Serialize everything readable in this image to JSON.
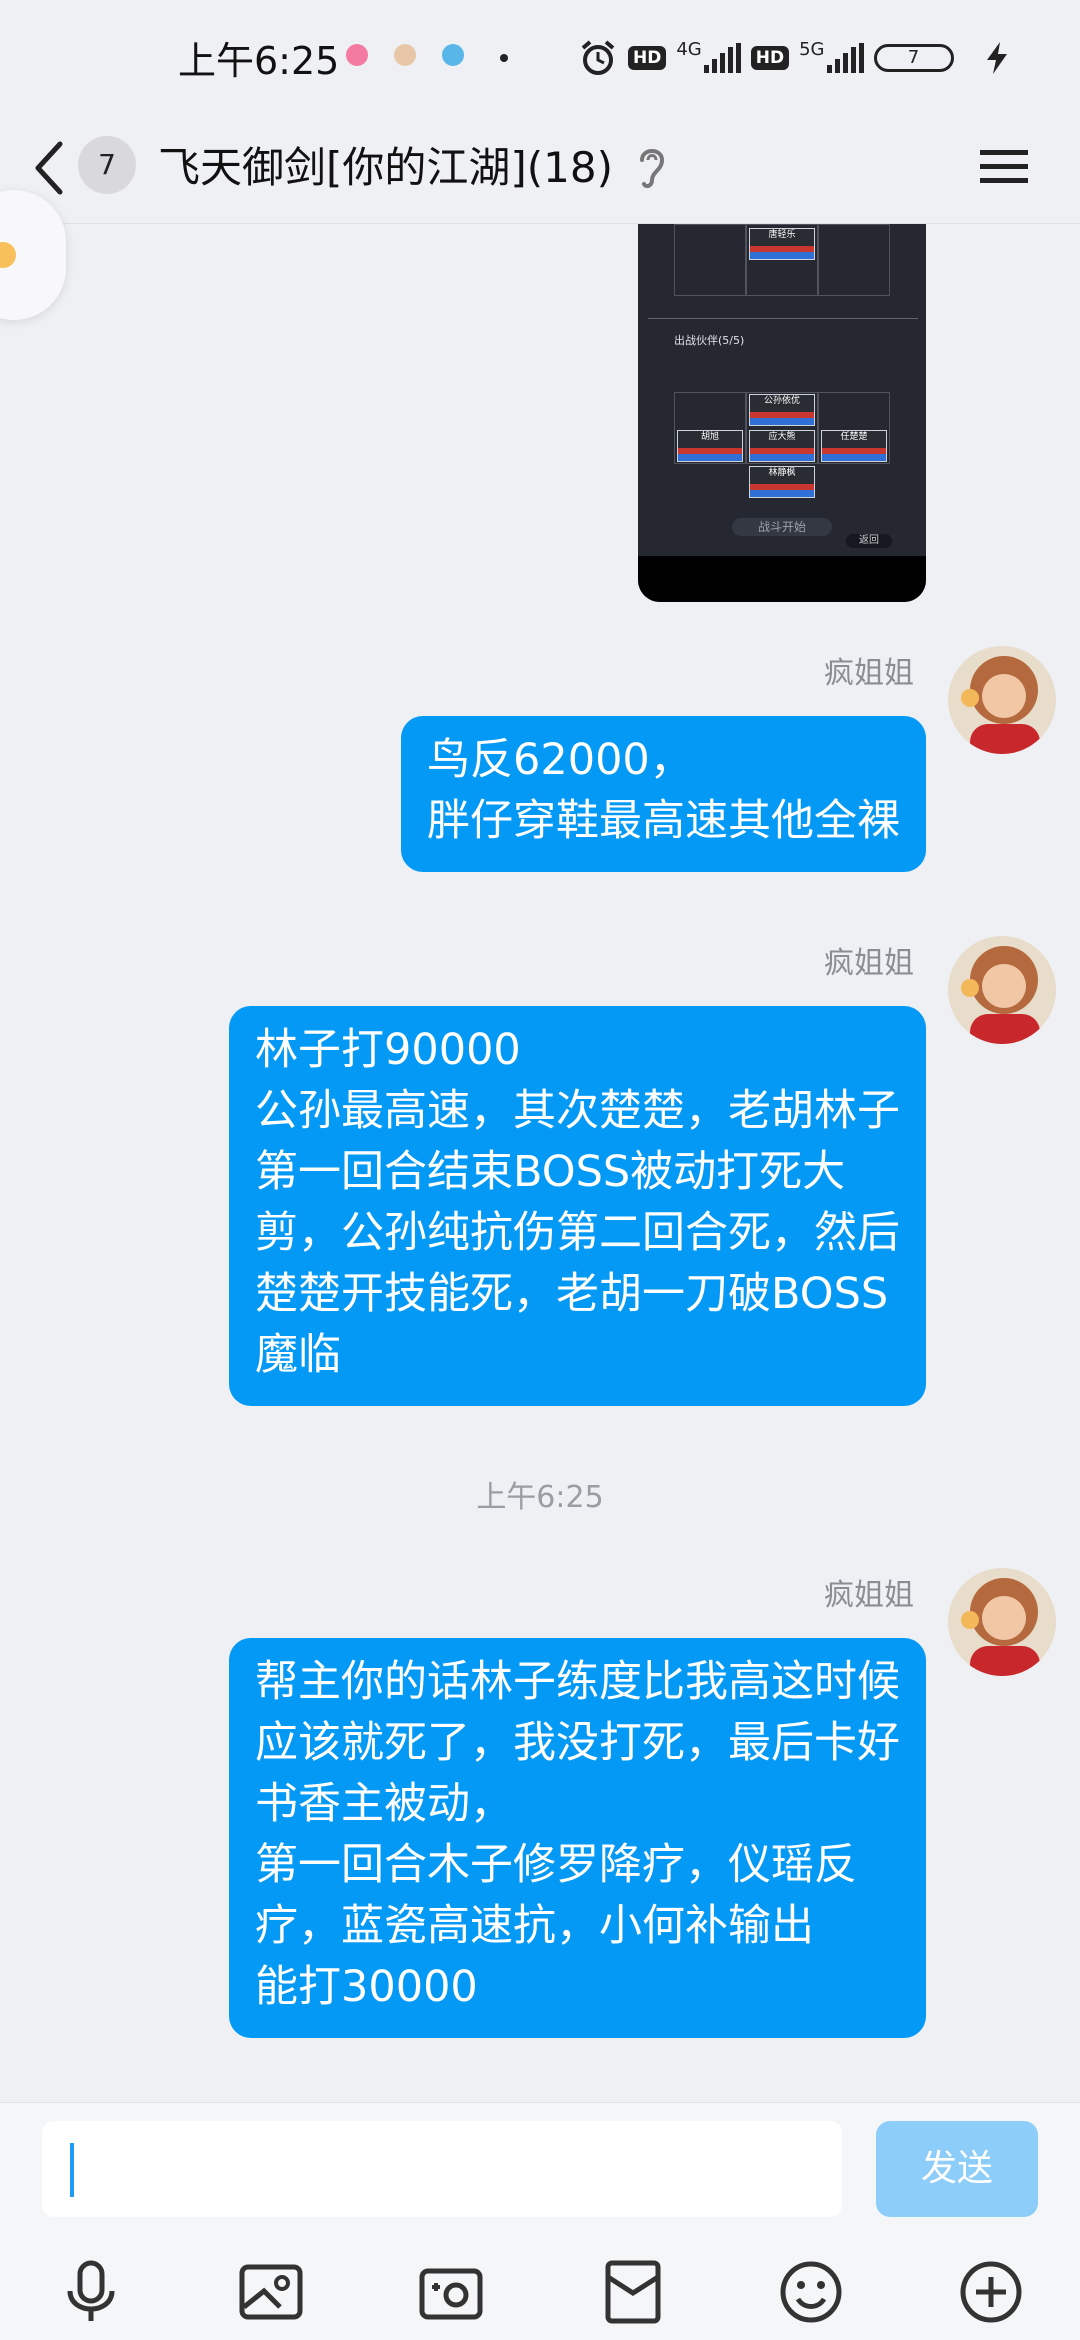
{
  "status_bar": {
    "time": "上午6:25",
    "hd": "HD",
    "net1": "4G",
    "net2": "5G",
    "battery": "7"
  },
  "header": {
    "back_badge": "7",
    "title": "飞天御剑[你的江湖](18)"
  },
  "image_message": {
    "card_top": "唐轻乐",
    "section_label": "出战伙伴(5/5)",
    "heroes": [
      "公孙依优",
      "胡旭",
      "应大熊",
      "任楚楚",
      "林静枫"
    ],
    "start_button": "战斗开始",
    "back_button": "返回"
  },
  "messages": [
    {
      "sender": "疯姐姐",
      "lines": [
        "鸟反62000，",
        "胖仔穿鞋最高速其他全裸"
      ]
    },
    {
      "sender": "疯姐姐",
      "lines": [
        "林子打90000",
        "公孙最高速，其次楚楚，老胡林子",
        "第一回合结束BOSS被动打死大",
        "剪，公孙纯抗伤第二回合死，然后",
        "楚楚开技能死，老胡一刀破BOSS",
        "魔临"
      ]
    },
    {
      "sender": "疯姐姐",
      "lines": [
        "帮主你的话林子练度比我高这时候",
        "应该就死了，我没打死，最后卡好",
        "书香主被动，",
        "第一回合木子修罗降疗，仪瑶反",
        "疗，蓝瓷高速抗，小何补输出",
        "能打30000"
      ]
    }
  ],
  "timestamp": "上午6:25",
  "input": {
    "value": "",
    "send_label": "发送"
  },
  "toolbar_icons": [
    "microphone-icon",
    "image-icon",
    "camera-icon",
    "red-packet-icon",
    "emoji-icon",
    "plus-icon"
  ],
  "colors": {
    "bubble": "#0599f6",
    "send_disabled": "#8dcdfa",
    "background": "#eef0f4"
  }
}
